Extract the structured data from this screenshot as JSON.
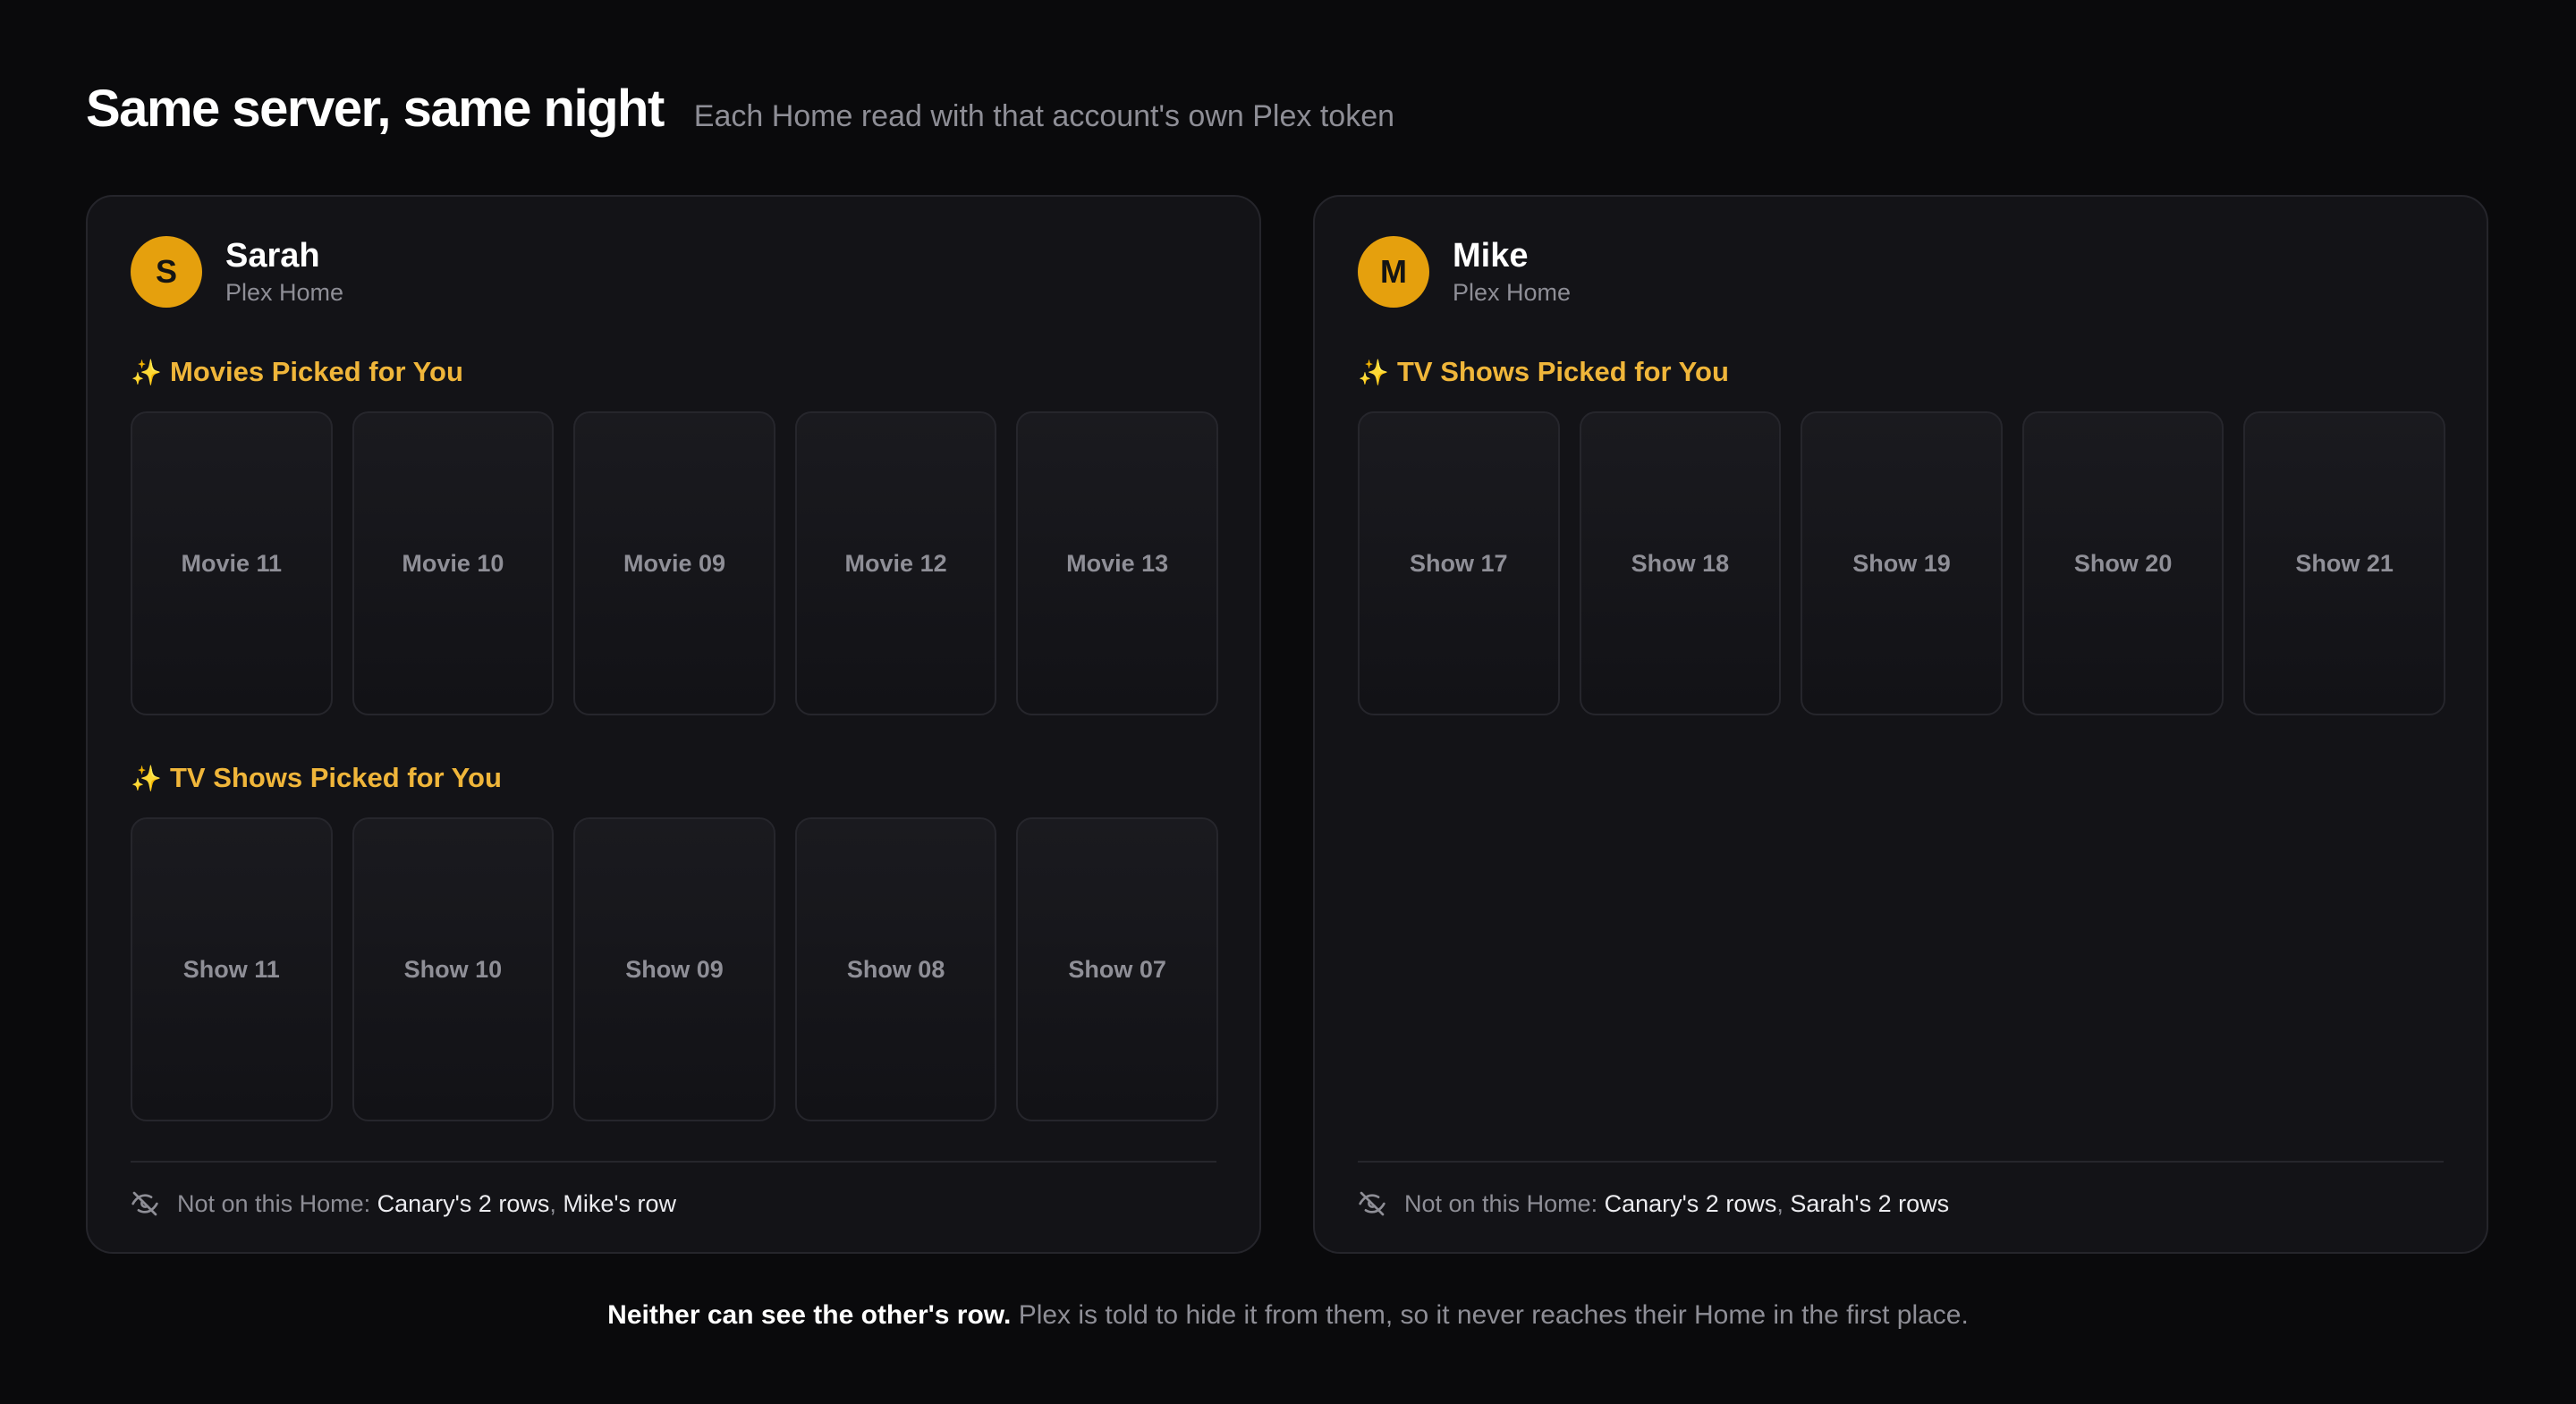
{
  "header": {
    "title": "Same server, same night",
    "subtitle": "Each Home read with that account's own Plex token"
  },
  "left": {
    "avatar_letter": "S",
    "name": "Sarah",
    "home_label": "Plex Home",
    "sections": [
      {
        "title": "Movies Picked for You",
        "items": [
          "Movie 11",
          "Movie 10",
          "Movie 09",
          "Movie 12",
          "Movie 13"
        ]
      },
      {
        "title": "TV Shows Picked for You",
        "items": [
          "Show 11",
          "Show 10",
          "Show 09",
          "Show 08",
          "Show 07"
        ]
      }
    ],
    "note_label": "Not on this Home:",
    "note_items": [
      "Canary's 2 rows",
      "Mike's row"
    ]
  },
  "right": {
    "avatar_letter": "M",
    "name": "Mike",
    "home_label": "Plex Home",
    "sections": [
      {
        "title": "TV Shows Picked for You",
        "items": [
          "Show 17",
          "Show 18",
          "Show 19",
          "Show 20",
          "Show 21"
        ]
      }
    ],
    "note_label": "Not on this Home:",
    "note_items": [
      "Canary's 2 rows",
      "Sarah's 2 rows"
    ]
  },
  "footer": {
    "strong": "Neither can see the other's row.",
    "rest": "Plex is told to hide it from them, so it never reaches their Home in the first place."
  },
  "colors": {
    "accent": "#e5a00d",
    "section_title": "#f0b63a",
    "background": "#0a0a0c",
    "panel": "#131317"
  },
  "icons": {
    "section": "sparkles-icon",
    "note": "eye-off-icon"
  }
}
